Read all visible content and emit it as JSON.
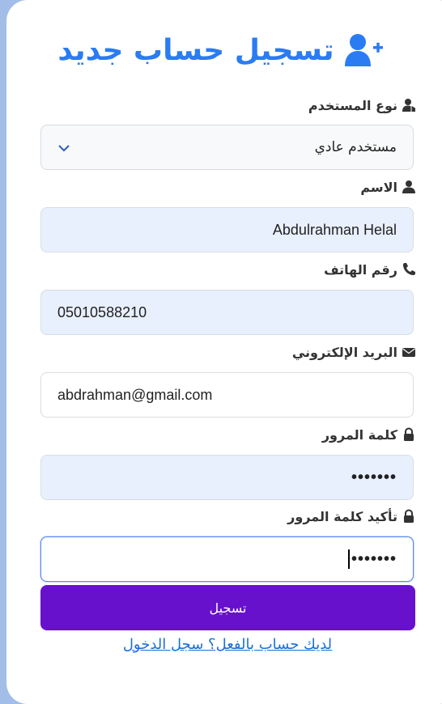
{
  "title": "تسجيل حساب جديد",
  "title_icon": "user-plus-icon",
  "colors": {
    "accent": "#2b7cf2",
    "button": "#6711cd",
    "link": "#1a6fd8",
    "filled_field": "#e8f0fe"
  },
  "fields": {
    "user_type": {
      "label": "نوع المستخدم",
      "icon": "user-tag-icon",
      "value": "مستخدم عادي"
    },
    "name": {
      "label": "الاسم",
      "icon": "user-icon",
      "value": "Abdulrahman Helal"
    },
    "phone": {
      "label": "رقم الهاتف",
      "icon": "phone-icon",
      "value": "05010588210"
    },
    "email": {
      "label": "البريد الإلكتروني",
      "icon": "envelope-icon",
      "value": "abdrahman@gmail.com"
    },
    "password": {
      "label": "كلمة المرور",
      "icon": "lock-icon",
      "value": "•••••••"
    },
    "confirm_password": {
      "label": "تأكيد كلمة المرور",
      "icon": "lock-icon",
      "value": "•••••••"
    }
  },
  "submit_label": "تسجيل",
  "login_link": "لديك حساب بالفعل؟ سجل الدخول"
}
